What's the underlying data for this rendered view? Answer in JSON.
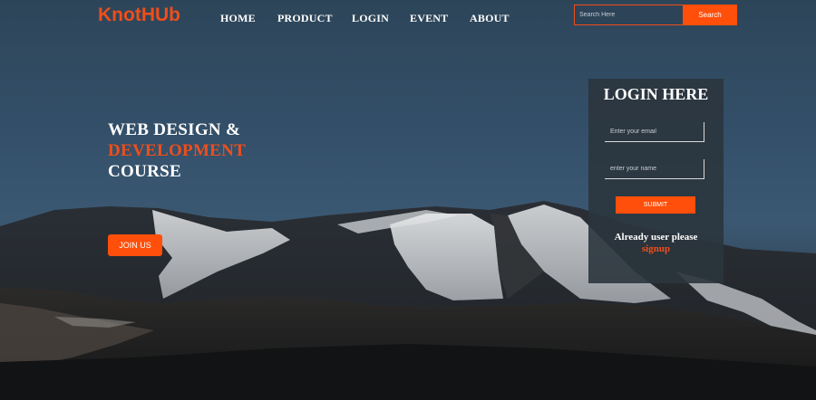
{
  "brand": {
    "logo_text": "KnotHUb",
    "accent_color": "#f04e1a"
  },
  "nav": {
    "items": [
      {
        "label": "HOME"
      },
      {
        "label": "PRODUCT"
      },
      {
        "label": "LOGIN"
      },
      {
        "label": "EVENT"
      },
      {
        "label": "ABOUT"
      }
    ]
  },
  "search": {
    "placeholder": "Search Here",
    "button_label": "Search"
  },
  "hero": {
    "line1": "WEB DESIGN &",
    "line2": "DEVELOPMENT",
    "line3": "COURSE",
    "cta_label": "JOIN US",
    "background": "mountain-landscape"
  },
  "login": {
    "title": "LOGIN HERE",
    "email_placeholder": "Enter your email",
    "name_placeholder": "enter your name",
    "submit_label": "SUBMIT",
    "already_text": "Already user please",
    "signup_label": "signup"
  }
}
